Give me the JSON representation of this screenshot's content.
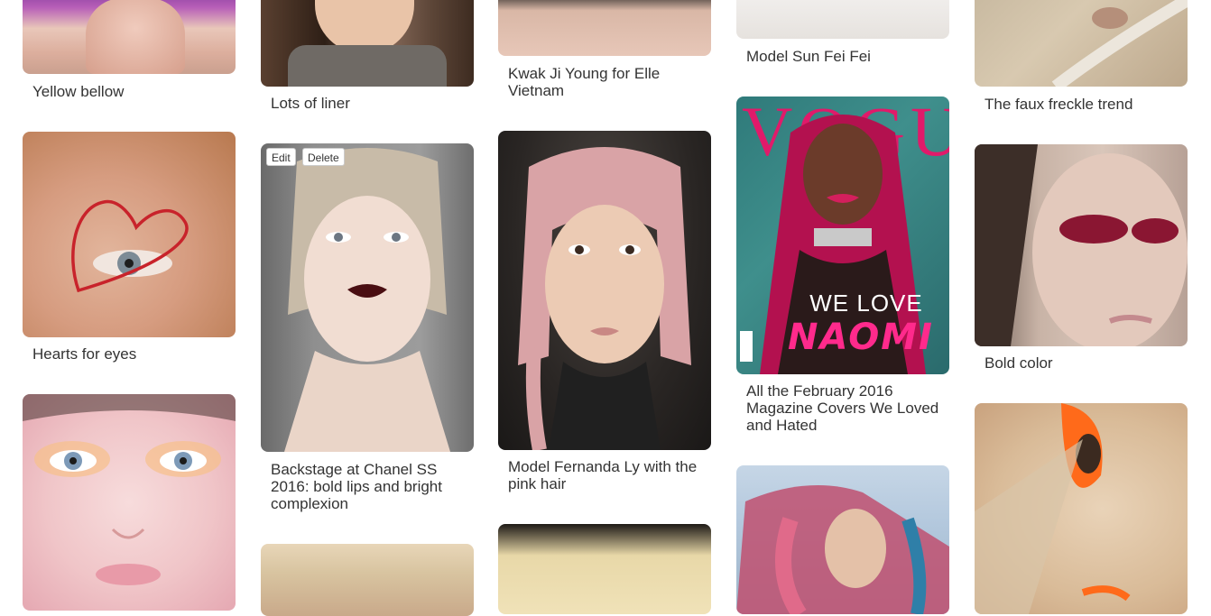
{
  "columns": [
    {
      "cards": [
        {
          "caption": "Yellow bellow"
        },
        {
          "caption": "Hearts for eyes"
        },
        {
          "caption": ""
        }
      ]
    },
    {
      "cards": [
        {
          "caption": "Lots of liner"
        },
        {
          "caption": "Backstage at Chanel SS 2016: bold lips and bright complexion",
          "actions": {
            "edit": "Edit",
            "delete": "Delete"
          }
        },
        {
          "caption": ""
        }
      ]
    },
    {
      "cards": [
        {
          "caption": "Kwak Ji Young for Elle Vietnam"
        },
        {
          "caption": "Model Fernanda Ly with the pink hair"
        },
        {
          "caption": ""
        }
      ]
    },
    {
      "cards": [
        {
          "caption": "Model Sun Fei Fei"
        },
        {
          "caption": "All the February 2016 Magazine Covers We Loved and Hated",
          "cover": {
            "logo": "VOGUE",
            "tagline": "WE LOVE",
            "name": "NAOMI"
          }
        },
        {
          "caption": ""
        }
      ]
    },
    {
      "cards": [
        {
          "caption": "The faux freckle trend"
        },
        {
          "caption": "Bold color"
        },
        {
          "caption": ""
        }
      ]
    }
  ],
  "colors": {
    "caption_text": "#333333",
    "page_background": "#ffffff",
    "vogue_pink": "#e01a6a"
  }
}
